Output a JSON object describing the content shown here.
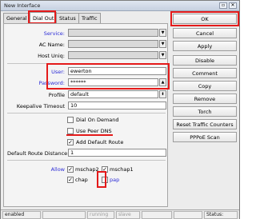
{
  "window": {
    "title": "New Interface"
  },
  "tabs": [
    {
      "label": "General"
    },
    {
      "label": "Dial Out"
    },
    {
      "label": "Status"
    },
    {
      "label": "Traffic"
    }
  ],
  "form": {
    "service_label": "Service:",
    "ac_name_label": "AC Name:",
    "host_uniq_label": "Host Uniq:",
    "user_label": "User:",
    "user_value": "ewerton",
    "password_label": "Password:",
    "password_value": "******",
    "profile_label": "Profile",
    "profile_value": "default",
    "keepalive_label": "Keepalive Timeout",
    "keepalive_value": "10",
    "dial_on_demand_label": "Dial On Demand",
    "use_peer_dns_label": "Use Peer DNS",
    "add_default_route_label": "Add Default Route",
    "default_route_distance_label": "Default Route Distance:",
    "default_route_distance_value": "1",
    "allow_label": "Allow",
    "allow_mschap2": "mschap2",
    "allow_mschap1": "mschap1",
    "allow_chap": "chap",
    "allow_pap": "pap"
  },
  "checks": {
    "dial_on_demand": false,
    "use_peer_dns": false,
    "add_default_route": true,
    "mschap2": true,
    "mschap1": true,
    "chap": true,
    "pap": false
  },
  "buttons": {
    "ok": "OK",
    "cancel": "Cancel",
    "apply": "Apply",
    "disable": "Disable",
    "comment": "Comment",
    "copy": "Copy",
    "remove": "Remove",
    "torch": "Torch",
    "reset_traffic": "Reset Traffic Counters",
    "pppoe_scan": "PPPoE Scan"
  },
  "status": {
    "enabled": "enabled",
    "running": "running",
    "slave": "slave",
    "status_label": "Status:"
  },
  "colors": {
    "highlight": "#e41a1a",
    "label_blue": "#2b2bd6"
  }
}
